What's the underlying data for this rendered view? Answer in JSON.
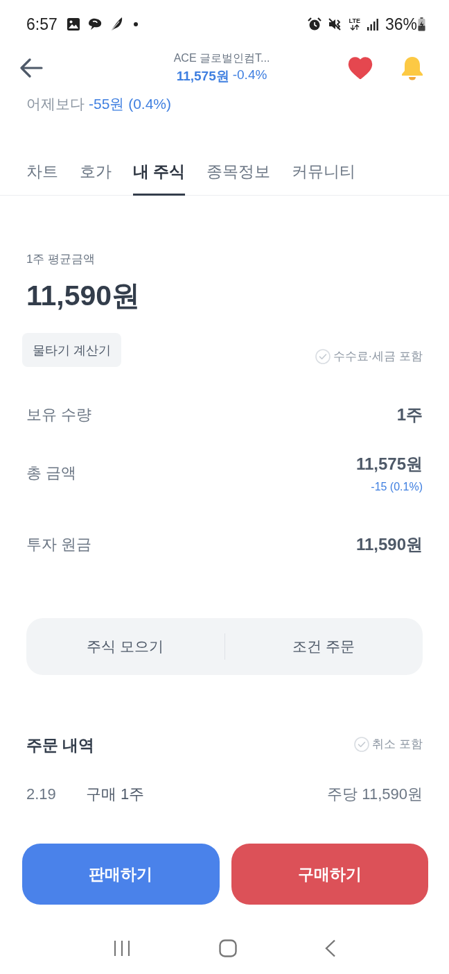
{
  "status_bar": {
    "time": "6:57",
    "network": "LTE",
    "battery": "36%"
  },
  "header": {
    "title": "ACE 글로벌인컴T...",
    "price": "11,575원",
    "change": "-0.4%",
    "favorite": true
  },
  "day_change": {
    "label": "어제보다",
    "value": "-55원 (0.4%)"
  },
  "tabs": [
    {
      "label": "차트",
      "selected": false
    },
    {
      "label": "호가",
      "selected": false
    },
    {
      "label": "내 주식",
      "selected": true
    },
    {
      "label": "종목정보",
      "selected": false
    },
    {
      "label": "커뮤니티",
      "selected": false
    }
  ],
  "average": {
    "label": "1주 평균금액",
    "value": "11,590원"
  },
  "calculator_button": "물타기 계산기",
  "fee_toggle": {
    "label": "수수료·세금 포함",
    "checked": false
  },
  "holdings": [
    {
      "label": "보유 수량",
      "value": "1주"
    },
    {
      "label": "총 금액",
      "value": "11,575원",
      "change": "-15 (0.1%)"
    },
    {
      "label": "투자 원금",
      "value": "11,590원"
    }
  ],
  "actions": [
    "주식 모으기",
    "조건 주문"
  ],
  "orders": {
    "title": "주문 내역",
    "filter": {
      "label": "취소 포함",
      "checked": false
    },
    "rows": [
      {
        "date": "2.19",
        "type": "구매 1주",
        "price": "주당 11,590원"
      }
    ]
  },
  "buttons": [
    {
      "label": "판매하기",
      "kind": "sell"
    },
    {
      "label": "구매하기",
      "kind": "buy"
    }
  ]
}
